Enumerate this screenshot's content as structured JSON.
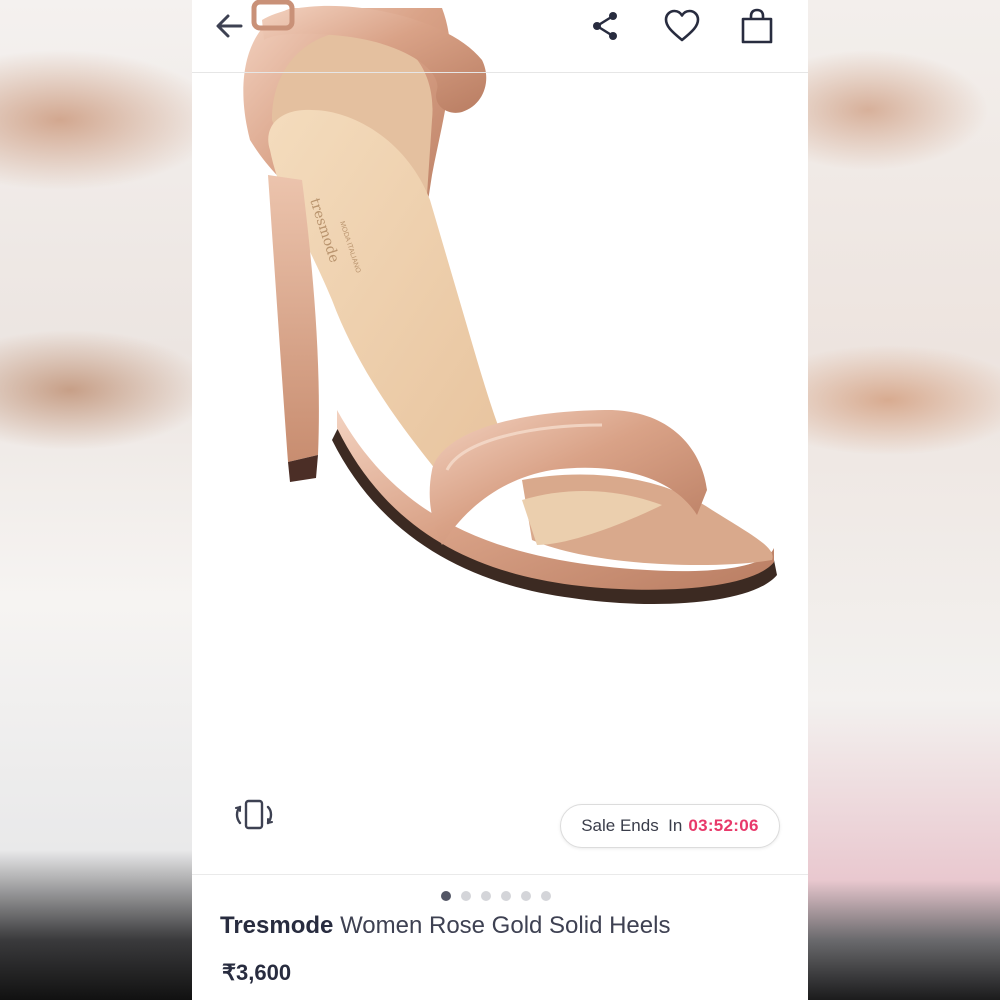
{
  "topbar": {
    "back_icon": "arrow-left-icon",
    "share_icon": "share-icon",
    "wishlist_icon": "heart-icon",
    "bag_icon": "shopping-bag-icon"
  },
  "gallery": {
    "image_alt": "Rose gold ankle strap stiletto sandal",
    "insole_logo_text": "tresmode",
    "insole_sub_text": "MODA ITALIANO",
    "rotate_icon": "rotate-view-icon",
    "dots_total": 6,
    "active_dot": 0
  },
  "sale": {
    "label": "Sale Ends  In",
    "timer": "03:52:06",
    "timer_color": "#e8396a"
  },
  "product": {
    "brand": "Tresmode",
    "name": "Women Rose Gold Solid Heels",
    "price": "₹3,600"
  },
  "colors": {
    "accent": "#e8396a",
    "text_dark": "#282c3f",
    "dot_active": "#535665",
    "dot_inactive": "#d4d5d9"
  }
}
